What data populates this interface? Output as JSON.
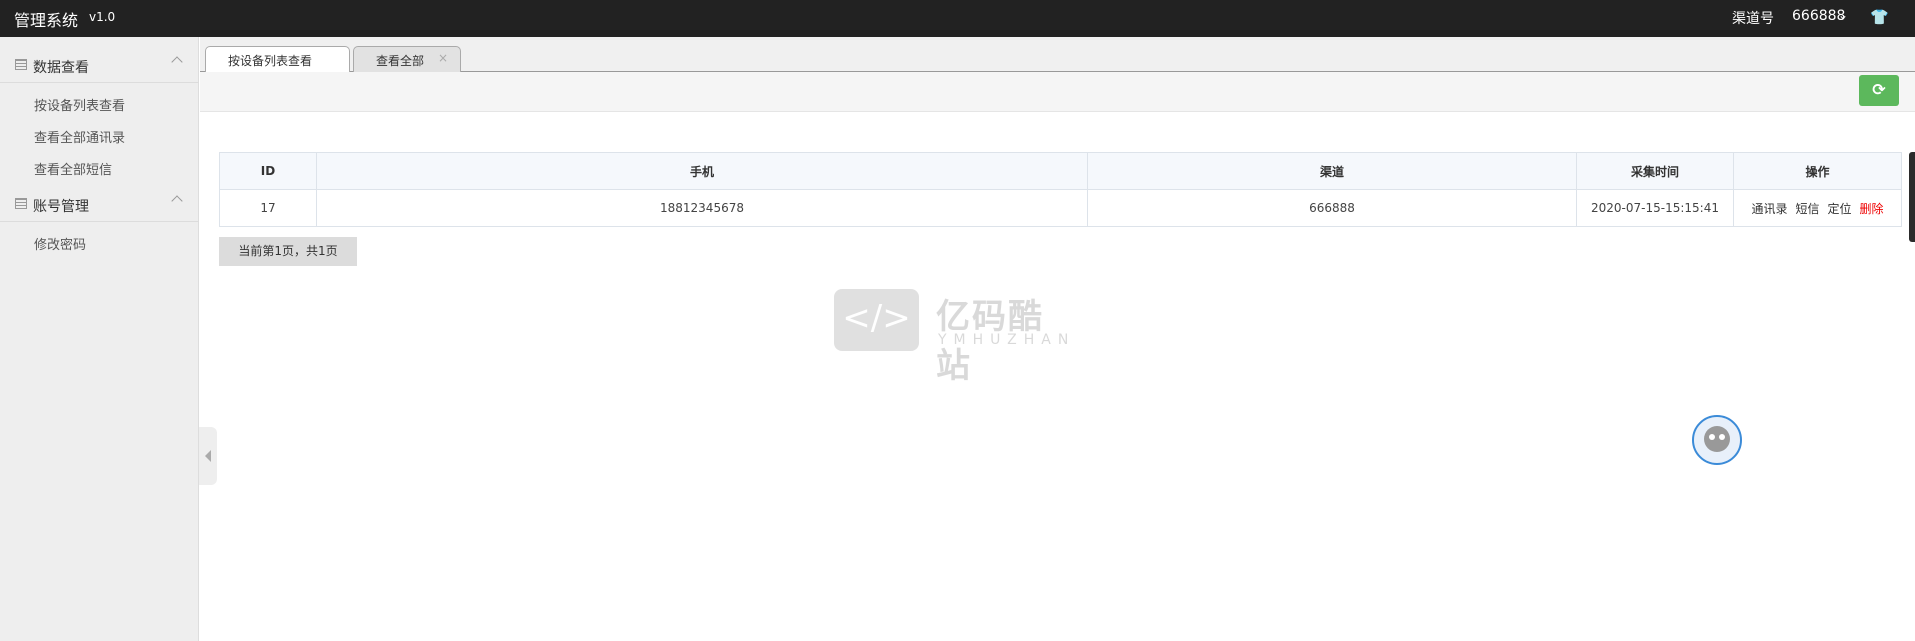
{
  "topbar": {
    "brand": "管理系统",
    "version": "v1.0",
    "channel_label": "渠道号",
    "channel_value": "666888",
    "chevron_icon": "chevron-down-icon",
    "shirt_icon": "tshirt-icon"
  },
  "sidebar": {
    "sections": [
      {
        "title": "数据查看",
        "items": [
          "按设备列表查看",
          "查看全部通讯录",
          "查看全部短信"
        ]
      },
      {
        "title": "账号管理",
        "items": [
          "修改密码"
        ]
      }
    ]
  },
  "tabs": [
    {
      "label": "按设备列表查看",
      "active": true
    },
    {
      "label": "查看全部",
      "active": false,
      "close": "×"
    }
  ],
  "toolbar": {
    "refresh_icon": "refresh-icon",
    "refresh_color": "#5cb85c"
  },
  "table": {
    "headers": [
      "ID",
      "手机",
      "渠道",
      "采集时间",
      "操作"
    ],
    "rows": [
      {
        "id": "17",
        "phone": "18812345678",
        "channel": "666888",
        "time": "2020-07-15-15:15:41",
        "actions": [
          "通讯录",
          "短信",
          "定位",
          "删除"
        ]
      }
    ],
    "delete_color": "#e00000"
  },
  "pager": {
    "text": "当前第1页，共1页"
  },
  "watermark": {
    "cn": "亿码酷站",
    "en": "YMHUZHAN"
  }
}
